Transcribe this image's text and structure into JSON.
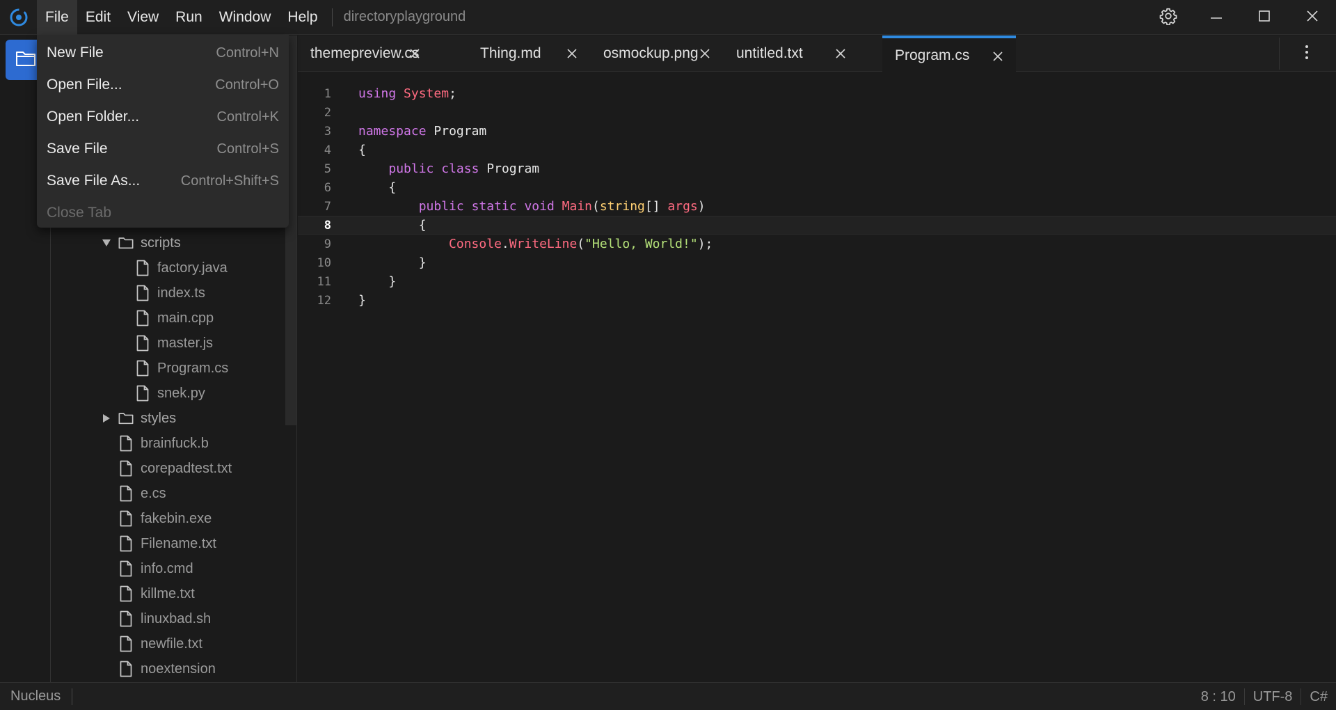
{
  "titlebar": {
    "menus": [
      "File",
      "Edit",
      "View",
      "Run",
      "Window",
      "Help"
    ],
    "project_name": "directoryplayground"
  },
  "file_menu": {
    "items": [
      {
        "label": "New File",
        "shortcut": "Control+N"
      },
      {
        "label": "Open File...",
        "shortcut": "Control+O"
      },
      {
        "label": "Open Folder...",
        "shortcut": "Control+K"
      },
      {
        "label": "Save File",
        "shortcut": "Control+S"
      },
      {
        "label": "Save File As...",
        "shortcut": "Control+Shift+S"
      },
      {
        "label": "Close Tab",
        "shortcut": ""
      }
    ]
  },
  "sidebar": {
    "scripts_folder": "scripts",
    "scripts_files": [
      "factory.java",
      "index.ts",
      "main.cpp",
      "master.js",
      "Program.cs",
      "snek.py"
    ],
    "styles_folder": "styles",
    "root_files": [
      "brainfuck.b",
      "corepadtest.txt",
      "e.cs",
      "fakebin.exe",
      "Filename.txt",
      "info.cmd",
      "killme.txt",
      "linuxbad.sh",
      "newfile.txt",
      "noextension"
    ]
  },
  "tabs": [
    {
      "label": "themepreview.cs"
    },
    {
      "label": "Thing.md"
    },
    {
      "label": "osmockup.png"
    },
    {
      "label": "untitled.txt"
    },
    {
      "label": "Program.cs"
    }
  ],
  "editor": {
    "line_numbers": [
      "1",
      "2",
      "3",
      "4",
      "5",
      "6",
      "7",
      "8",
      "9",
      "10",
      "11",
      "12"
    ],
    "current_line": "8",
    "tokens": {
      "using": "using",
      "system": "System",
      "semicolon": ";",
      "namespace": "namespace",
      "ns_name": "Program",
      "open_brace": "{",
      "close_brace": "}",
      "public": "public",
      "class": "class",
      "class_name": "Program",
      "static": "static",
      "void": "void",
      "main": "Main",
      "paren_open": "(",
      "string_type": "string",
      "brackets": "[]",
      "args": "args",
      "paren_close": ")",
      "console": "Console",
      "dot": ".",
      "writeline": "WriteLine",
      "hello": "\"Hello, World!\"",
      "end_call": ");"
    }
  },
  "statusbar": {
    "app_name": "Nucleus",
    "cursor": "8 : 10",
    "encoding": "UTF-8",
    "language": "C#"
  },
  "colors": {
    "accent": "#2f8ae0",
    "explorer_active": "#2d6bd1",
    "keyword": "#d077e8",
    "type": "#ff6b81",
    "string": "#b6e37a",
    "param_type": "#ffd073"
  },
  "icons": {
    "logo": "app-logo-icon",
    "explorer": "folder-icon",
    "settings": "gear-icon",
    "minimize": "minimize-icon",
    "maximize": "maximize-icon",
    "close": "close-icon",
    "more": "more-vertical-icon"
  }
}
